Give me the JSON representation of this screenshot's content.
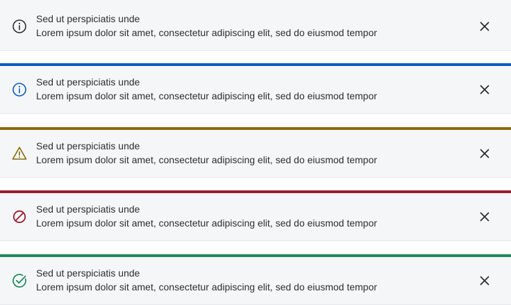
{
  "banners": [
    {
      "variant": "neutral",
      "icon": "info-icon",
      "accent_color": "",
      "icon_color": "#2e2e2e",
      "title": "Sed ut perspiciatis unde",
      "message": "Lorem ipsum dolor sit amet, consectetur adipiscing elit, sed do eiusmod tempor",
      "close_icon": "close-icon"
    },
    {
      "variant": "info",
      "icon": "info-icon",
      "accent_color": "#0b5cc2",
      "icon_color": "#0b5cc2",
      "title": "Sed ut perspiciatis unde",
      "message": "Lorem ipsum dolor sit amet, consectetur adipiscing elit, sed do eiusmod tempor",
      "close_icon": "close-icon"
    },
    {
      "variant": "warning",
      "icon": "warning-icon",
      "accent_color": "#8a6a0c",
      "icon_color": "#8a6a0c",
      "title": "Sed ut perspiciatis unde",
      "message": "Lorem ipsum dolor sit amet, consectetur adipiscing elit, sed do eiusmod tempor",
      "close_icon": "close-icon"
    },
    {
      "variant": "error",
      "icon": "blocked-icon",
      "accent_color": "#9b1b2a",
      "icon_color": "#9b1b2a",
      "title": "Sed ut perspiciatis unde",
      "message": "Lorem ipsum dolor sit amet, consectetur adipiscing elit, sed do eiusmod tempor",
      "close_icon": "close-icon"
    },
    {
      "variant": "success",
      "icon": "check-circle-icon",
      "accent_color": "#1e8a5a",
      "icon_color": "#1e8a5a",
      "title": "Sed ut perspiciatis unde",
      "message": "Lorem ipsum dolor sit amet, consectetur adipiscing elit, sed do eiusmod tempor",
      "close_icon": "close-icon"
    }
  ]
}
